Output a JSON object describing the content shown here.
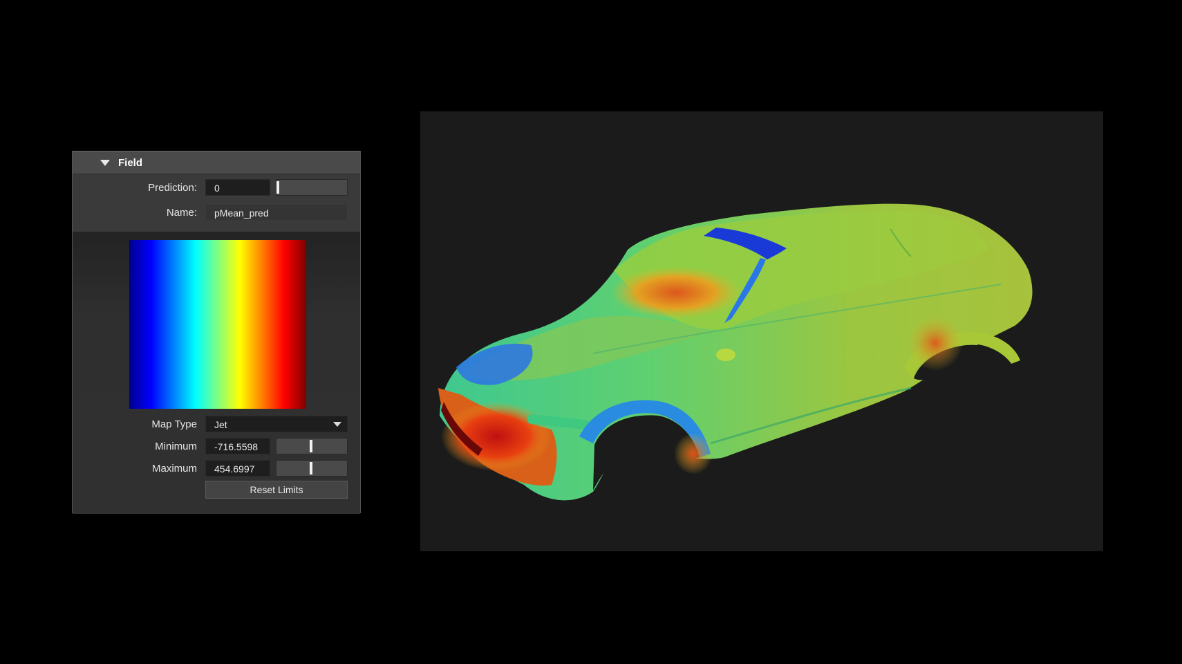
{
  "field_panel": {
    "title": "Field",
    "prediction_label": "Prediction:",
    "prediction_value": "0",
    "prediction_slider_fraction": 0.0,
    "name_label": "Name:",
    "name_value": "pMean_pred",
    "map_type_label": "Map Type",
    "map_type_value": "Jet",
    "minimum_label": "Minimum",
    "minimum_value": "-716.5598",
    "minimum_slider_fraction": 0.5,
    "maximum_label": "Maximum",
    "maximum_value": "454.6997",
    "maximum_slider_fraction": 0.5,
    "reset_button_label": "Reset Limits",
    "colormap_colors": [
      "#00008f",
      "#0000ff",
      "#0080ff",
      "#00ffff",
      "#80ff80",
      "#ffff00",
      "#ff8000",
      "#ff0000",
      "#800000"
    ]
  },
  "viewport": {
    "background_color": "#1b1b1b",
    "content": "car-pressure-field-render"
  }
}
